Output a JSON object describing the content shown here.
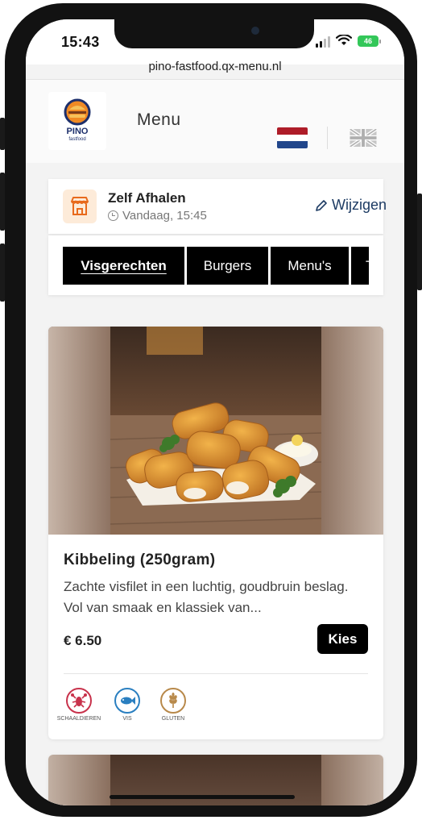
{
  "status_bar": {
    "time": "15:43",
    "battery": "46"
  },
  "browser": {
    "url": "pino-fastfood.qx-menu.nl"
  },
  "header": {
    "logo_text": "PINO",
    "logo_sub": "fastfood",
    "title": "Menu",
    "languages": [
      {
        "name": "Nederlands",
        "icon": "flag-nl-icon",
        "active": true
      },
      {
        "name": "English",
        "icon": "flag-uk-icon",
        "active": false
      }
    ]
  },
  "pickup": {
    "title": "Zelf Afhalen",
    "time": "Vandaag, 15:45",
    "edit_label": "Wijzigen",
    "icon": "store-icon",
    "icon_color": "#e86a1c"
  },
  "tabs": [
    {
      "label": "Visgerechten",
      "active": true
    },
    {
      "label": "Burgers",
      "active": false
    },
    {
      "label": "Menu's",
      "active": false
    },
    {
      "label": "T",
      "active": false
    }
  ],
  "products": [
    {
      "name": "Kibbeling (250gram)",
      "description": "Zachte visfilet in een luchtig, goudbruin beslag. Vol van smaak en klassiek van...",
      "price": "€ 6.50",
      "button_label": "Kies",
      "allergens": [
        {
          "label": "SCHAALDIEREN",
          "icon": "lobster-icon",
          "color": "#c8324b"
        },
        {
          "label": "VIS",
          "icon": "fish-icon",
          "color": "#2a7fc0"
        },
        {
          "label": "GLUTEN",
          "icon": "wheat-icon",
          "color": "#b8894a"
        }
      ]
    }
  ],
  "colors": {
    "accent": "#000000",
    "link": "#1d3b63",
    "background": "#f3f3f3"
  }
}
